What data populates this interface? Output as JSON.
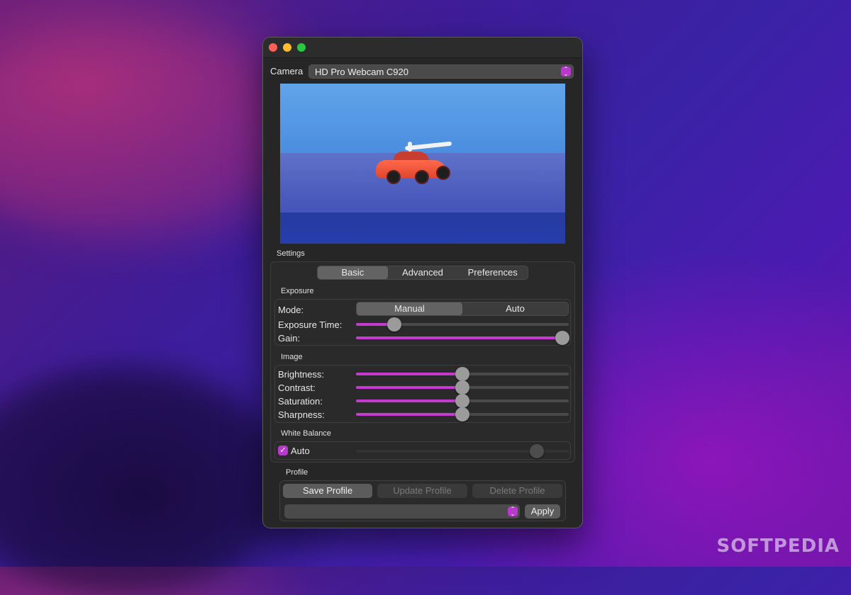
{
  "camera": {
    "label": "Camera",
    "selected": "HD Pro Webcam C920"
  },
  "settings": {
    "label": "Settings",
    "tabs": [
      "Basic",
      "Advanced",
      "Preferences"
    ],
    "active_tab": "Basic"
  },
  "exposure": {
    "label": "Exposure",
    "mode_label": "Mode:",
    "modes": [
      "Manual",
      "Auto"
    ],
    "active_mode": "Manual",
    "exposure_time_label": "Exposure Time:",
    "exposure_time_level": 0.18,
    "gain_label": "Gain:",
    "gain_level": 0.97
  },
  "image": {
    "label": "Image",
    "brightness_label": "Brightness:",
    "brightness_level": 0.5,
    "contrast_label": "Contrast:",
    "contrast_level": 0.5,
    "saturation_label": "Saturation:",
    "saturation_level": 0.5,
    "sharpness_label": "Sharpness:",
    "sharpness_level": 0.5
  },
  "white_balance": {
    "label": "White Balance",
    "auto_label": "Auto",
    "auto_checked": true,
    "level": 0.85
  },
  "profile": {
    "label": "Profile",
    "save_label": "Save Profile",
    "update_label": "Update Profile",
    "delete_label": "Delete Profile",
    "apply_label": "Apply",
    "selected": ""
  },
  "watermark": "SOFTPEDIA",
  "colors": {
    "accent": "#c63ad2",
    "window_bg": "#262626"
  }
}
